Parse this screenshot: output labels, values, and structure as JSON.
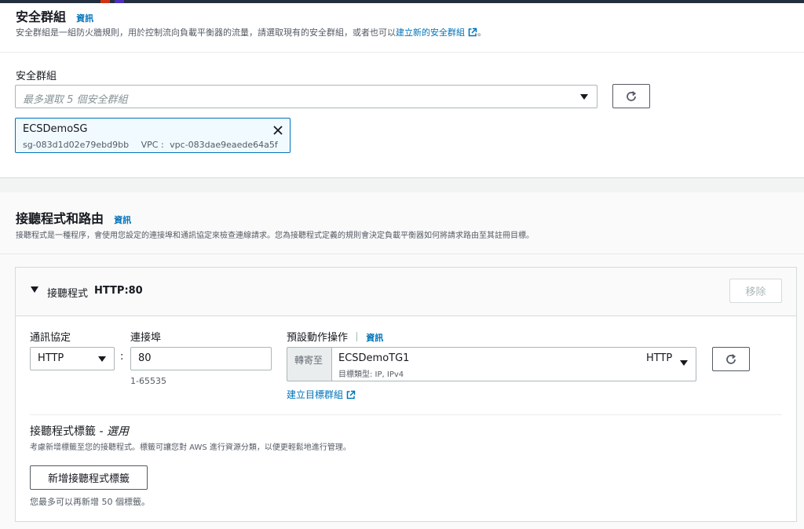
{
  "security_groups_section": {
    "title": "安全群組",
    "info_link": "資訊",
    "description_prefix": "安全群組是一組防火牆規則，用於控制流向負載平衡器的流量，請選取現有的安全群組，或者也可以",
    "description_link": "建立新的安全群組",
    "description_suffix": "。",
    "field_label": "安全群組",
    "select_placeholder": "最多選取 5 個安全群組",
    "selected_token": {
      "name": "ECSDemoSG",
      "id": "sg-083d1d02e79ebd9bb",
      "vpc_label": "VPC :",
      "vpc_id": "vpc-083dae9eaede64a5f"
    }
  },
  "listeners_section": {
    "title": "接聽程式和路由",
    "info_link": "資訊",
    "description": "接聽程式是一種程序，會使用您設定的連接埠和通訊協定來檢查連線請求。您為接聽程式定義的規則會決定負載平衡器如何將請求路由至其註冊目標。",
    "listener": {
      "header_label": "接聽程式",
      "header_value": "HTTP:80",
      "remove_button": "移除",
      "protocol_label": "通訊協定",
      "protocol_value": "HTTP",
      "colon": ":",
      "port_label": "連接埠",
      "port_value": "80",
      "port_hint": "1-65535",
      "default_action_label": "預設動作操作",
      "default_action_info": "資訊",
      "forward_to_label": "轉寄至",
      "target_group_name": "ECSDemoTG1",
      "target_group_protocol": "HTTP",
      "target_group_meta": "目標類型: IP, IPv4",
      "create_target_group_link": "建立目標群組",
      "tags_title": "接聽程式標籤 - ",
      "tags_optional": "選用",
      "tags_description": "考慮新增標籤至您的接聽程式。標籤可讓您對 AWS 進行資源分類，以便更輕鬆地進行管理。",
      "add_tag_button": "新增接聽程式標籤",
      "tags_remaining": "您最多可以再新增 50 個標籤。"
    }
  },
  "colors": {
    "link": "#0073bb",
    "border": "#aab7b8",
    "token_bg": "#f1faff",
    "page_bg": "#f2f3f3"
  }
}
